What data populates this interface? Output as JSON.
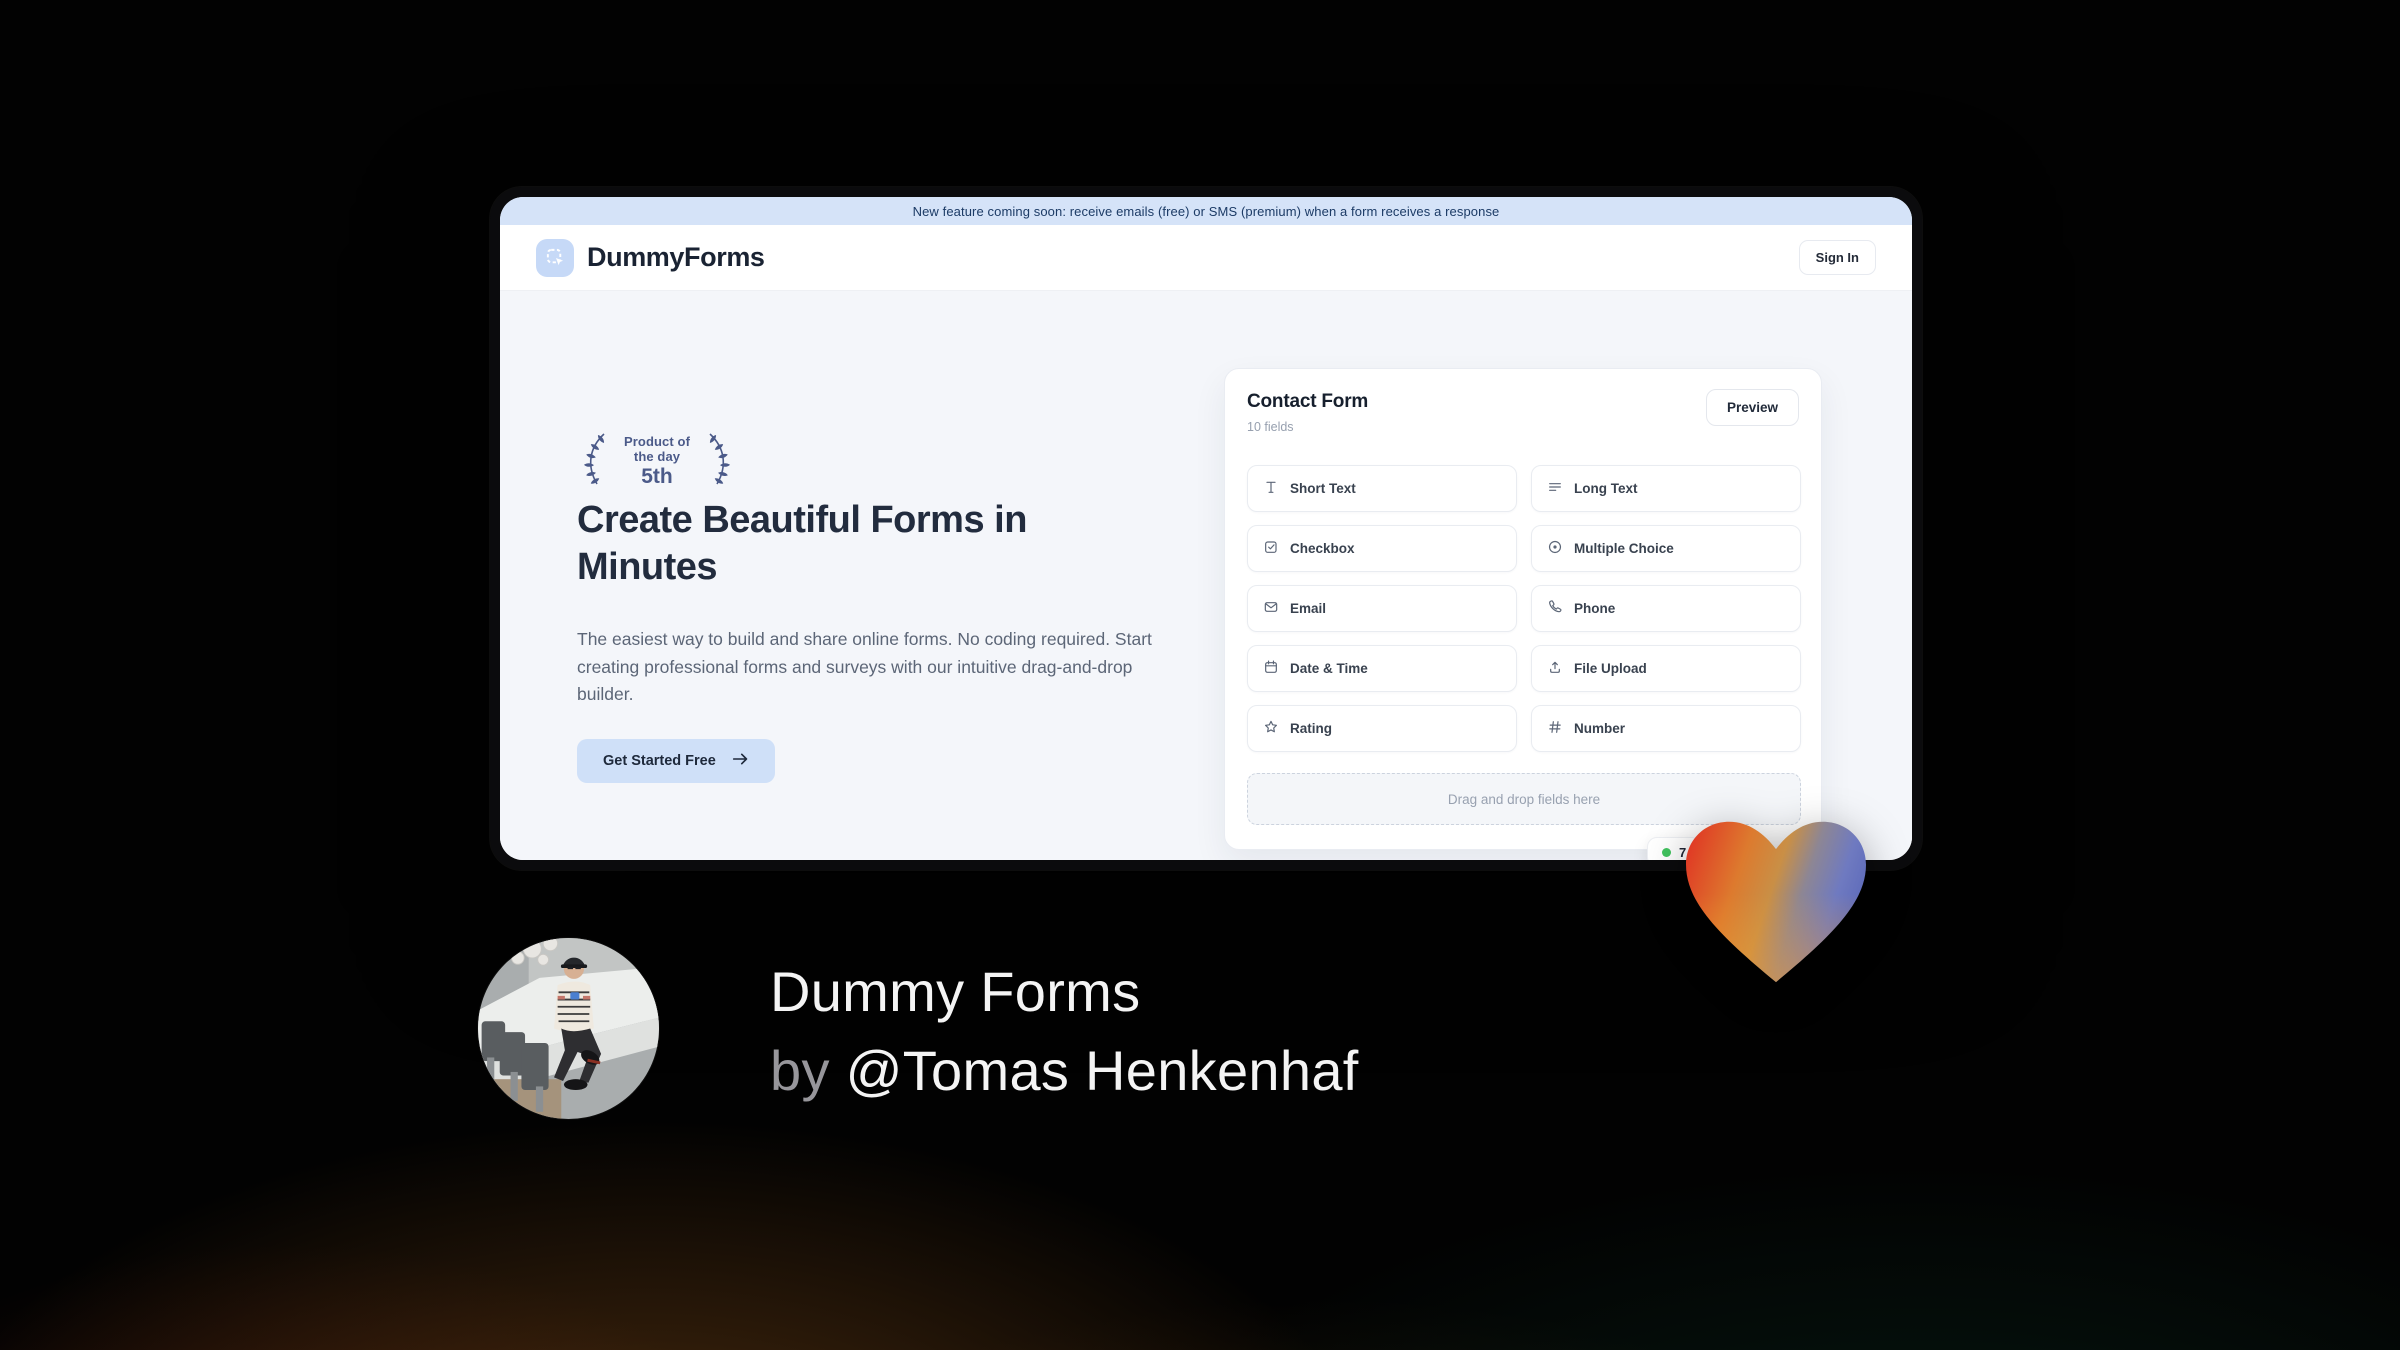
{
  "announcement_banner": {
    "text": "New feature coming soon: receive emails (free) or SMS (premium) when a form receives a response"
  },
  "header": {
    "brand": "DummyForms",
    "sign_in_label": "Sign In"
  },
  "hero": {
    "award_badge": {
      "line1": "Product of the day",
      "line2": "5th"
    },
    "title_line1": "Create Beautiful Forms in",
    "title_line2": "Minutes",
    "description": "The easiest way to build and share online forms. No coding required. Start creating professional forms and surveys with our intuitive drag-and-drop builder.",
    "cta_label": "Get Started Free"
  },
  "form_builder": {
    "title": "Contact Form",
    "field_count": "10 fields",
    "preview_label": "Preview",
    "fields": [
      {
        "icon": "text-icon",
        "label": "Short Text"
      },
      {
        "icon": "lines-icon",
        "label": "Long Text"
      },
      {
        "icon": "checkbox-icon",
        "label": "Checkbox"
      },
      {
        "icon": "radio-icon",
        "label": "Multiple Choice"
      },
      {
        "icon": "mail-icon",
        "label": "Email"
      },
      {
        "icon": "phone-icon",
        "label": "Phone"
      },
      {
        "icon": "calendar-icon",
        "label": "Date & Time"
      },
      {
        "icon": "upload-icon",
        "label": "File Upload"
      },
      {
        "icon": "star-icon",
        "label": "Rating"
      },
      {
        "icon": "hash-icon",
        "label": "Number"
      }
    ],
    "dropzone_text": "Drag and drop fields here",
    "floating_badge": {
      "text": "7",
      "dot_color": "#41c35e"
    }
  },
  "caption": {
    "line1": "Dummy Forms",
    "by": "by ",
    "author": "@Tomas Henkenhaf"
  },
  "colors": {
    "banner_bg": "#d5e3f8",
    "accent_blue": "#cfe0f8",
    "navy_text": "#222c3e",
    "slate_badge": "#4b5a89",
    "page_bg": "#f4f6fa",
    "green_dot": "#41c35e",
    "heart_red": "#e03524",
    "heart_orange": "#f09b2e",
    "heart_blue": "#6471bd"
  }
}
